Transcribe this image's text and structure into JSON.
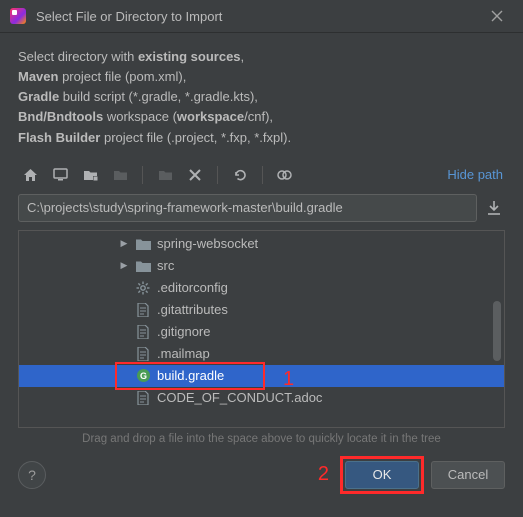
{
  "window": {
    "title": "Select File or Directory to Import"
  },
  "intro": {
    "line1_pre": "Select directory with ",
    "line1_bold": "existing sources",
    "line1_post": ",",
    "line2_bold": "Maven",
    "line2_post": " project file (pom.xml),",
    "line3_bold": "Gradle",
    "line3_post": " build script (*.gradle, *.gradle.kts),",
    "line4_bold": "Bnd/Bndtools",
    "line4_mid": " workspace (",
    "line4_bold2": "workspace",
    "line4_post": "/cnf),",
    "line5_bold": "Flash Builder",
    "line5_post": " project file (.project, *.fxp, *.fxpl)."
  },
  "toolbar": {
    "hide_path": "Hide path"
  },
  "path": {
    "value": "C:\\projects\\study\\spring-framework-master\\build.gradle"
  },
  "tree": {
    "items": [
      {
        "label": "spring-websocket",
        "icon": "folder",
        "expandable": true
      },
      {
        "label": "src",
        "icon": "folder",
        "expandable": true
      },
      {
        "label": ".editorconfig",
        "icon": "gear",
        "expandable": false
      },
      {
        "label": ".gitattributes",
        "icon": "file",
        "expandable": false
      },
      {
        "label": ".gitignore",
        "icon": "file",
        "expandable": false
      },
      {
        "label": ".mailmap",
        "icon": "file",
        "expandable": false
      },
      {
        "label": "build.gradle",
        "icon": "gradle",
        "expandable": false,
        "selected": true
      },
      {
        "label": "CODE_OF_CONDUCT.adoc",
        "icon": "file",
        "expandable": false
      }
    ]
  },
  "hint": "Drag and drop a file into the space above to quickly locate it in the tree",
  "footer": {
    "ok": "OK",
    "cancel": "Cancel"
  },
  "annotations": {
    "a1": "1",
    "a2": "2"
  }
}
